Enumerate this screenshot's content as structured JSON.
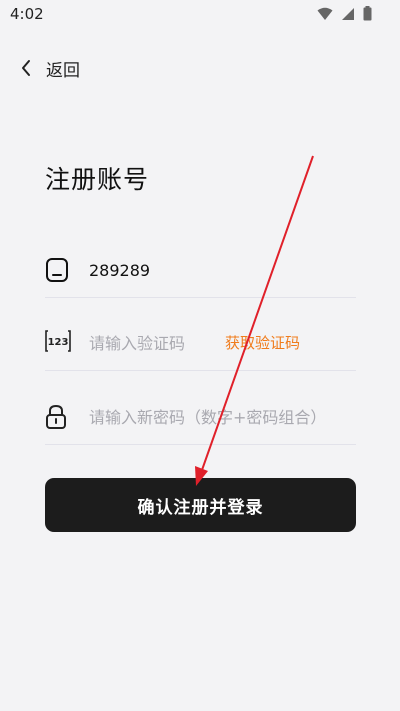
{
  "status_bar": {
    "time": "4:02",
    "icons": [
      "wifi-icon",
      "signal-icon",
      "battery-icon"
    ]
  },
  "header": {
    "back_label": "返回"
  },
  "page": {
    "title": "注册账号"
  },
  "form": {
    "phone": {
      "value": "289289",
      "icon": "phone-icon"
    },
    "code": {
      "placeholder": "请输入验证码",
      "icon": "code-123-icon",
      "get_code_label": "获取验证码"
    },
    "password": {
      "placeholder": "请输入新密码（数字+密码组合）",
      "icon": "lock-icon"
    },
    "submit_label": "确认注册并登录"
  },
  "colors": {
    "background": "#f3f3f5",
    "button": "#1c1c1c",
    "accent": "#f07c1c",
    "annotation_arrow": "#e0202a"
  }
}
